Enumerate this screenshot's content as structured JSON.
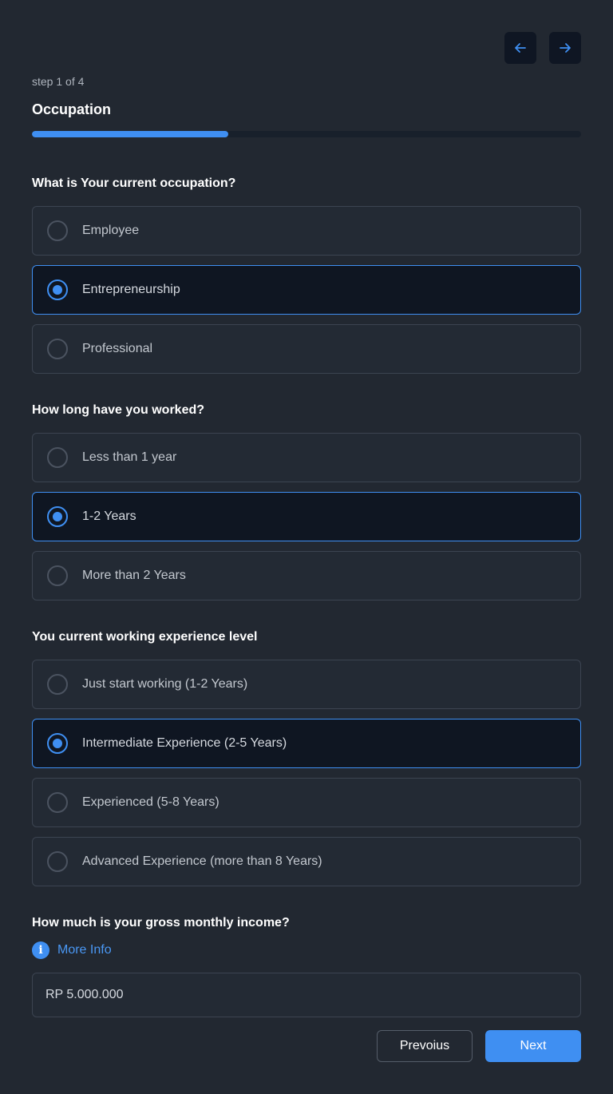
{
  "header": {
    "step_text": "step 1 of 4",
    "title": "Occupation",
    "progress_fraction": 0.357,
    "back_icon": "arrow-left-icon",
    "forward_icon": "arrow-right-icon"
  },
  "colors": {
    "accent": "#3f8ff2",
    "background": "#222831",
    "selected_bg": "#0f1622"
  },
  "questions": [
    {
      "label": "What is Your current occupation?",
      "options": [
        "Employee",
        "Entrepreneurship",
        "Professional"
      ],
      "selected": 1
    },
    {
      "label": "How long have you worked?",
      "options": [
        "Less than 1 year",
        "1-2 Years",
        "More than 2 Years"
      ],
      "selected": 1
    },
    {
      "label": "You current working experience level",
      "options": [
        "Just start working (1-2 Years)",
        "Intermediate Experience (2-5 Years)",
        "Experienced (5-8 Years)",
        "Advanced Experience (more than 8 Years)"
      ],
      "selected": 1
    }
  ],
  "income": {
    "label": "How much is your gross monthly income?",
    "info_icon": "info-icon",
    "info_glyph": "i",
    "info_link": "More Info",
    "value": "RP 5.000.000"
  },
  "footer": {
    "previous_label": "Prevoius",
    "next_label": "Next"
  }
}
